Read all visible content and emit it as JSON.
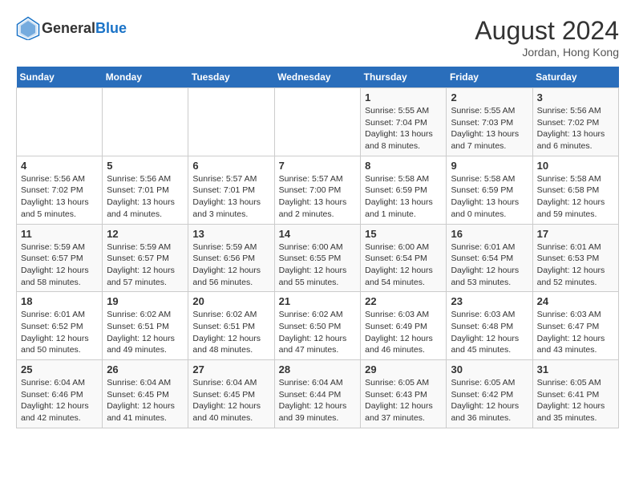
{
  "header": {
    "logo_general": "General",
    "logo_blue": "Blue",
    "month_year": "August 2024",
    "location": "Jordan, Hong Kong"
  },
  "calendar": {
    "days_of_week": [
      "Sunday",
      "Monday",
      "Tuesday",
      "Wednesday",
      "Thursday",
      "Friday",
      "Saturday"
    ],
    "weeks": [
      [
        {
          "day": "",
          "info": ""
        },
        {
          "day": "",
          "info": ""
        },
        {
          "day": "",
          "info": ""
        },
        {
          "day": "",
          "info": ""
        },
        {
          "day": "1",
          "info": "Sunrise: 5:55 AM\nSunset: 7:04 PM\nDaylight: 13 hours\nand 8 minutes."
        },
        {
          "day": "2",
          "info": "Sunrise: 5:55 AM\nSunset: 7:03 PM\nDaylight: 13 hours\nand 7 minutes."
        },
        {
          "day": "3",
          "info": "Sunrise: 5:56 AM\nSunset: 7:02 PM\nDaylight: 13 hours\nand 6 minutes."
        }
      ],
      [
        {
          "day": "4",
          "info": "Sunrise: 5:56 AM\nSunset: 7:02 PM\nDaylight: 13 hours\nand 5 minutes."
        },
        {
          "day": "5",
          "info": "Sunrise: 5:56 AM\nSunset: 7:01 PM\nDaylight: 13 hours\nand 4 minutes."
        },
        {
          "day": "6",
          "info": "Sunrise: 5:57 AM\nSunset: 7:01 PM\nDaylight: 13 hours\nand 3 minutes."
        },
        {
          "day": "7",
          "info": "Sunrise: 5:57 AM\nSunset: 7:00 PM\nDaylight: 13 hours\nand 2 minutes."
        },
        {
          "day": "8",
          "info": "Sunrise: 5:58 AM\nSunset: 6:59 PM\nDaylight: 13 hours\nand 1 minute."
        },
        {
          "day": "9",
          "info": "Sunrise: 5:58 AM\nSunset: 6:59 PM\nDaylight: 13 hours\nand 0 minutes."
        },
        {
          "day": "10",
          "info": "Sunrise: 5:58 AM\nSunset: 6:58 PM\nDaylight: 12 hours\nand 59 minutes."
        }
      ],
      [
        {
          "day": "11",
          "info": "Sunrise: 5:59 AM\nSunset: 6:57 PM\nDaylight: 12 hours\nand 58 minutes."
        },
        {
          "day": "12",
          "info": "Sunrise: 5:59 AM\nSunset: 6:57 PM\nDaylight: 12 hours\nand 57 minutes."
        },
        {
          "day": "13",
          "info": "Sunrise: 5:59 AM\nSunset: 6:56 PM\nDaylight: 12 hours\nand 56 minutes."
        },
        {
          "day": "14",
          "info": "Sunrise: 6:00 AM\nSunset: 6:55 PM\nDaylight: 12 hours\nand 55 minutes."
        },
        {
          "day": "15",
          "info": "Sunrise: 6:00 AM\nSunset: 6:54 PM\nDaylight: 12 hours\nand 54 minutes."
        },
        {
          "day": "16",
          "info": "Sunrise: 6:01 AM\nSunset: 6:54 PM\nDaylight: 12 hours\nand 53 minutes."
        },
        {
          "day": "17",
          "info": "Sunrise: 6:01 AM\nSunset: 6:53 PM\nDaylight: 12 hours\nand 52 minutes."
        }
      ],
      [
        {
          "day": "18",
          "info": "Sunrise: 6:01 AM\nSunset: 6:52 PM\nDaylight: 12 hours\nand 50 minutes."
        },
        {
          "day": "19",
          "info": "Sunrise: 6:02 AM\nSunset: 6:51 PM\nDaylight: 12 hours\nand 49 minutes."
        },
        {
          "day": "20",
          "info": "Sunrise: 6:02 AM\nSunset: 6:51 PM\nDaylight: 12 hours\nand 48 minutes."
        },
        {
          "day": "21",
          "info": "Sunrise: 6:02 AM\nSunset: 6:50 PM\nDaylight: 12 hours\nand 47 minutes."
        },
        {
          "day": "22",
          "info": "Sunrise: 6:03 AM\nSunset: 6:49 PM\nDaylight: 12 hours\nand 46 minutes."
        },
        {
          "day": "23",
          "info": "Sunrise: 6:03 AM\nSunset: 6:48 PM\nDaylight: 12 hours\nand 45 minutes."
        },
        {
          "day": "24",
          "info": "Sunrise: 6:03 AM\nSunset: 6:47 PM\nDaylight: 12 hours\nand 43 minutes."
        }
      ],
      [
        {
          "day": "25",
          "info": "Sunrise: 6:04 AM\nSunset: 6:46 PM\nDaylight: 12 hours\nand 42 minutes."
        },
        {
          "day": "26",
          "info": "Sunrise: 6:04 AM\nSunset: 6:45 PM\nDaylight: 12 hours\nand 41 minutes."
        },
        {
          "day": "27",
          "info": "Sunrise: 6:04 AM\nSunset: 6:45 PM\nDaylight: 12 hours\nand 40 minutes."
        },
        {
          "day": "28",
          "info": "Sunrise: 6:04 AM\nSunset: 6:44 PM\nDaylight: 12 hours\nand 39 minutes."
        },
        {
          "day": "29",
          "info": "Sunrise: 6:05 AM\nSunset: 6:43 PM\nDaylight: 12 hours\nand 37 minutes."
        },
        {
          "day": "30",
          "info": "Sunrise: 6:05 AM\nSunset: 6:42 PM\nDaylight: 12 hours\nand 36 minutes."
        },
        {
          "day": "31",
          "info": "Sunrise: 6:05 AM\nSunset: 6:41 PM\nDaylight: 12 hours\nand 35 minutes."
        }
      ]
    ]
  }
}
